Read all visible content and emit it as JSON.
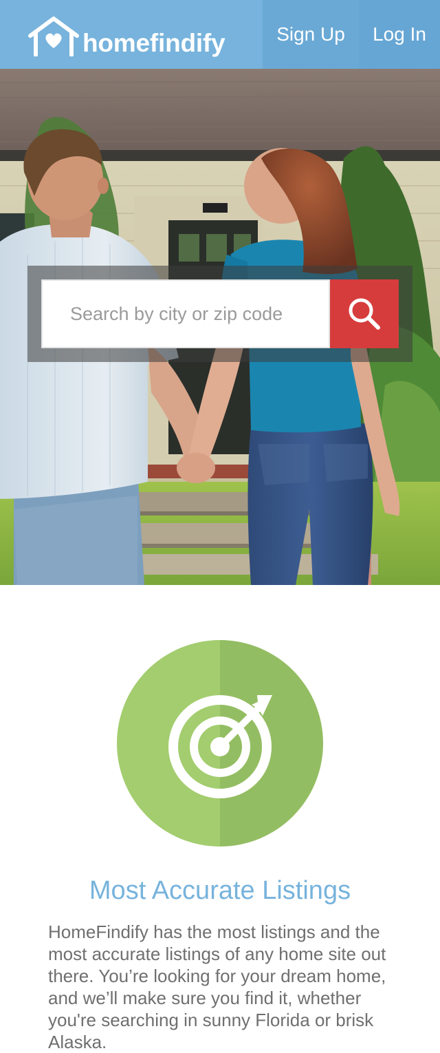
{
  "header": {
    "logo_text": "homefindify",
    "signup_label": "Sign Up",
    "login_label": "Log In"
  },
  "search": {
    "placeholder": "Search by city or zip code",
    "value": ""
  },
  "feature": {
    "icon": "target-icon",
    "title": "Most Accurate Listings",
    "body": "HomeFindify has the most listings and the most accurate listings of any home site out there. You’re looking for your dream home, and we’ll make sure you find it, whether you're searching in sunny Florida or brisk Alaska."
  },
  "colors": {
    "header_blue": "#77b3dc",
    "search_red": "#d63c3c",
    "feature_green_light": "#a3cd6e",
    "feature_green_dark": "#93bd62",
    "body_text_gray": "#6f6f6f"
  }
}
